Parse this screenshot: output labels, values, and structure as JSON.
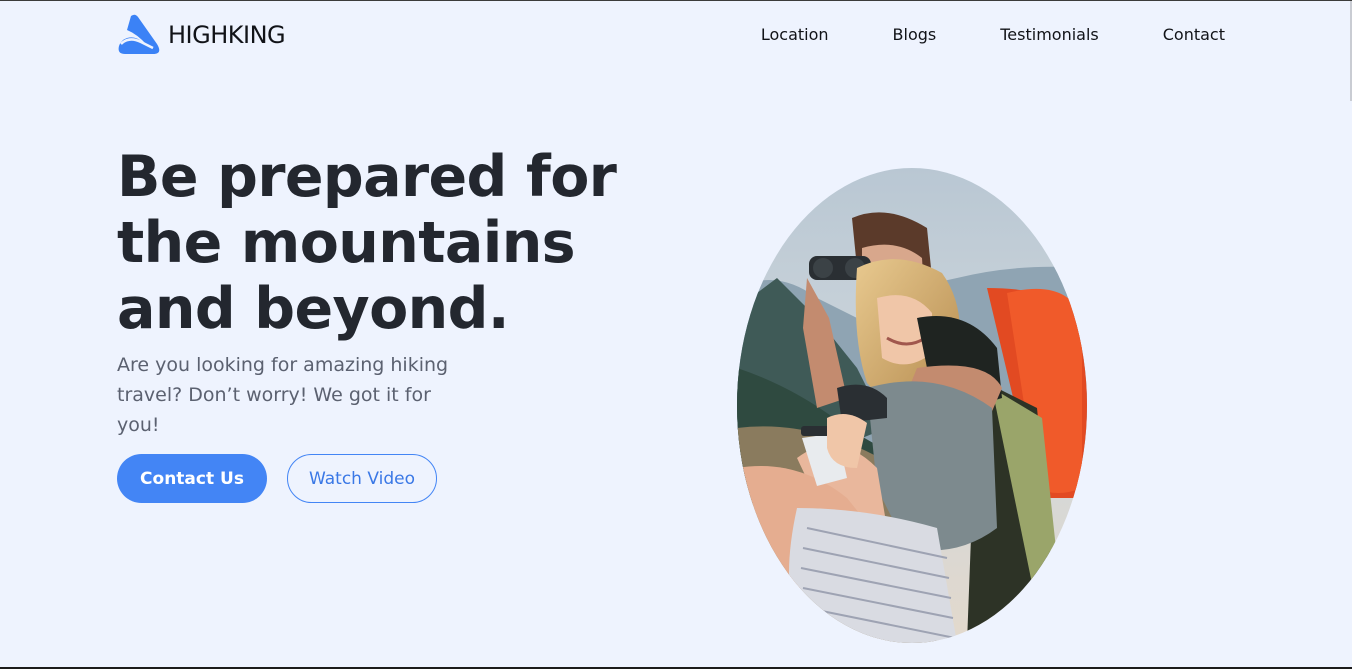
{
  "brand": {
    "name": "HIGHKING",
    "icon": "mountain-logo-icon",
    "color": "#3b82f6"
  },
  "nav": {
    "items": [
      {
        "label": "Location"
      },
      {
        "label": "Blogs"
      },
      {
        "label": "Testimonials"
      },
      {
        "label": "Contact"
      }
    ]
  },
  "hero": {
    "title": "Be prepared for the mountains and beyond.",
    "subtitle": "Are you looking for amazing hiking travel? Don’t worry! We got it for you!",
    "primary_button": "Contact Us",
    "secondary_button": "Watch Video"
  },
  "image": {
    "alt": "hiking-couple-photo"
  },
  "colors": {
    "background": "#eef3fe",
    "accent": "#4385f5",
    "heading": "#23272f",
    "body": "#5b6170"
  }
}
